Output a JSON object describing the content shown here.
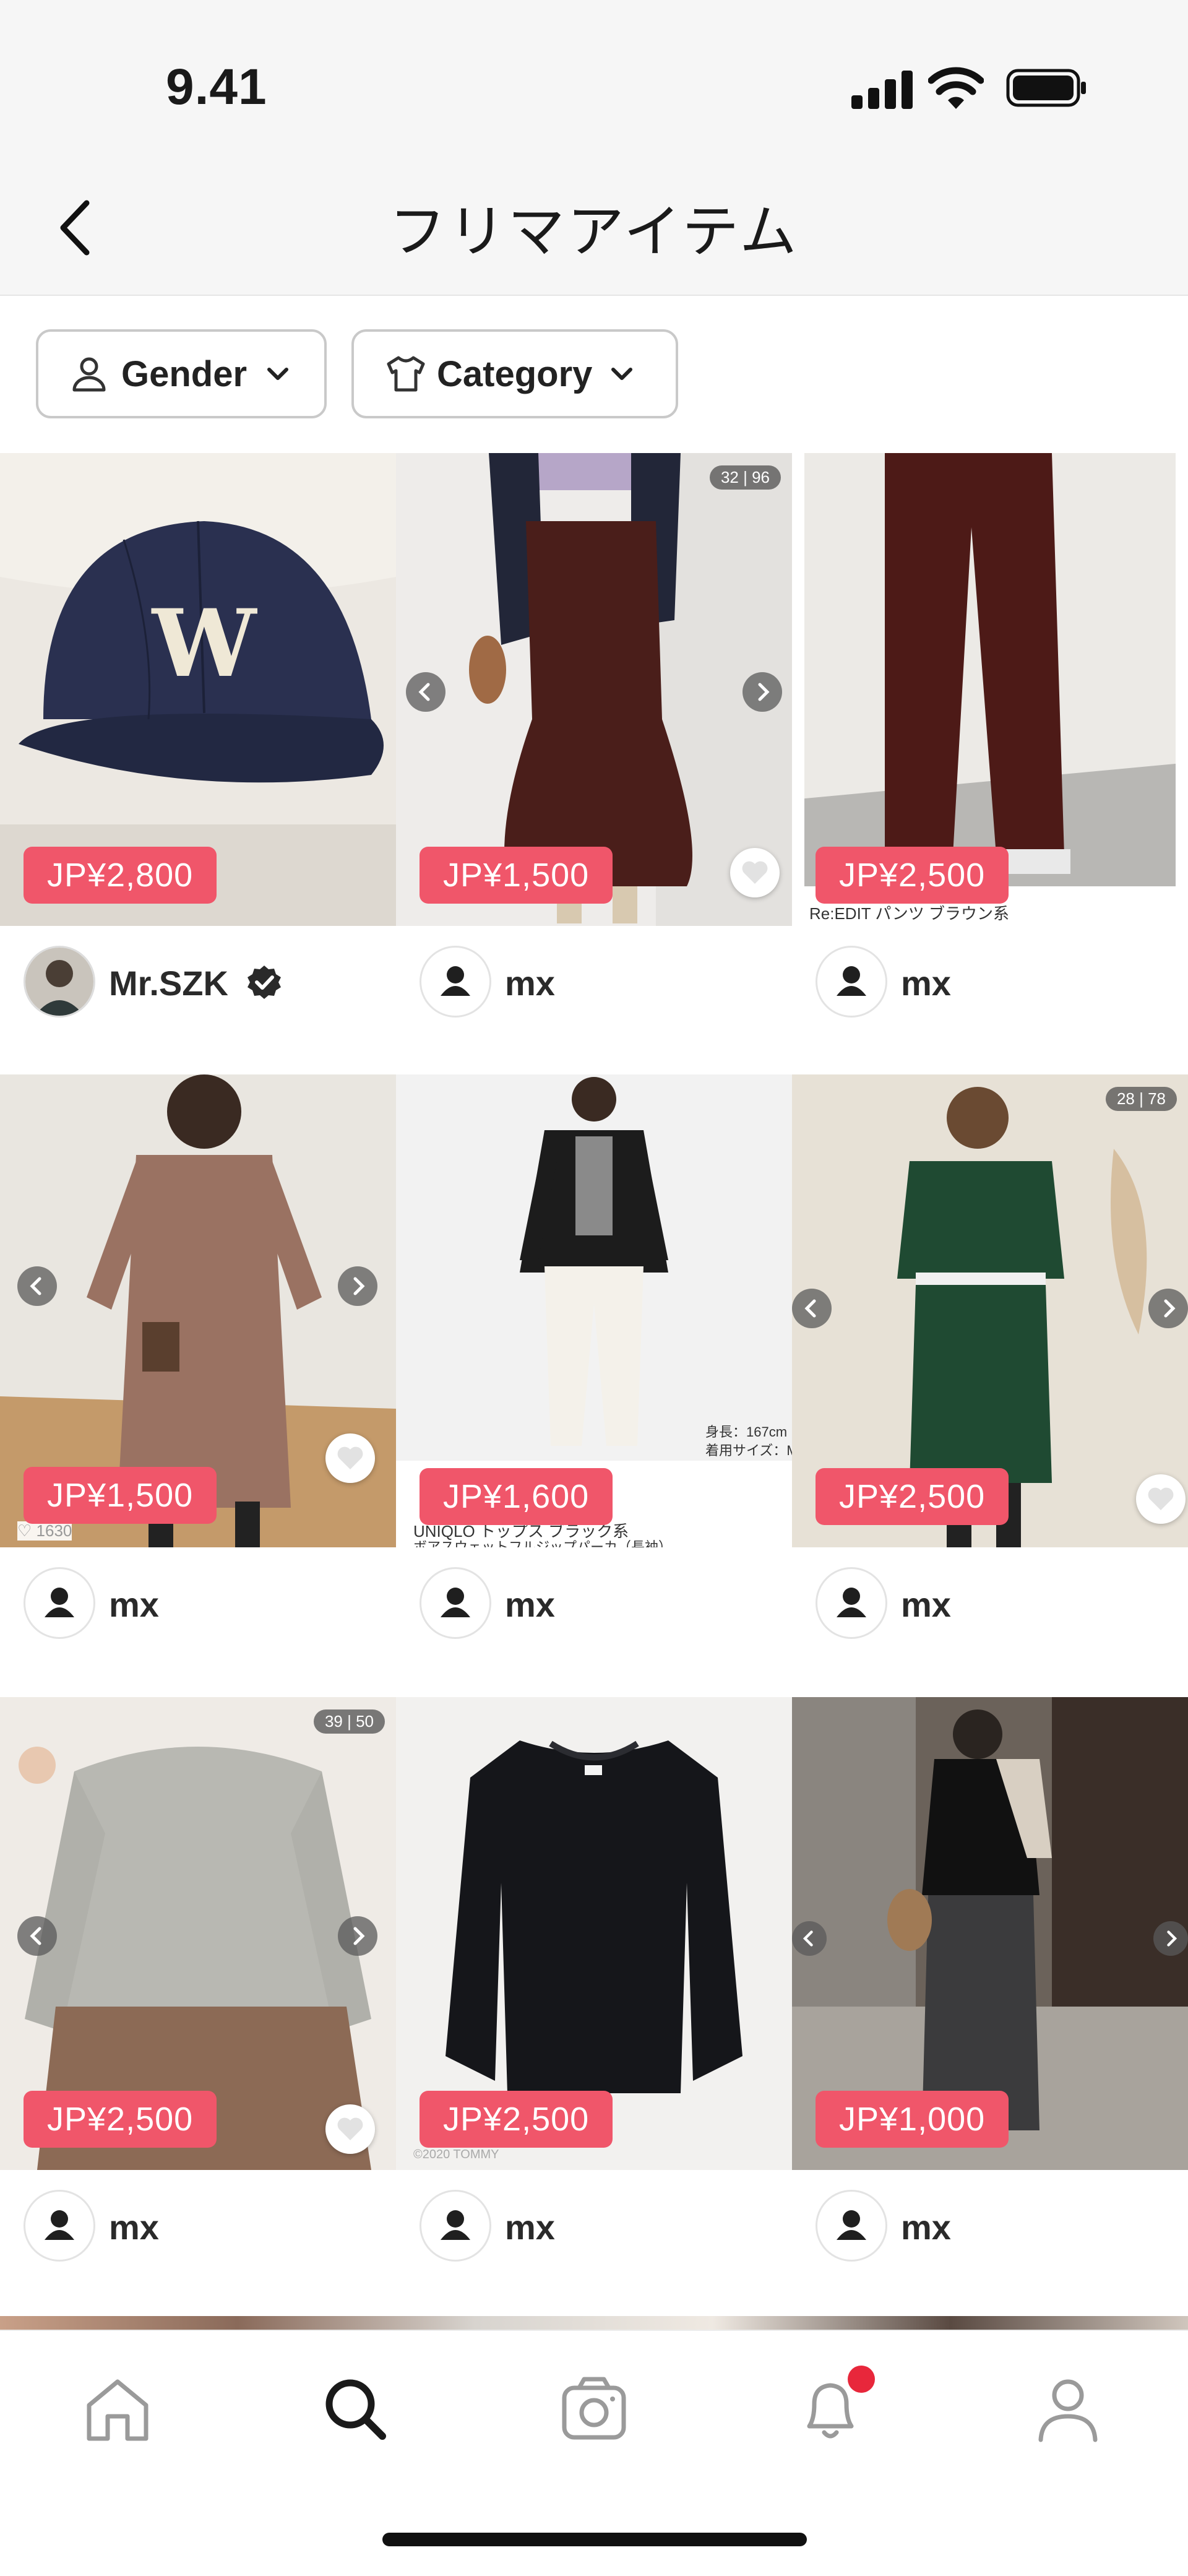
{
  "status_bar": {
    "time": "9.41"
  },
  "header": {
    "title": "フリマアイテム"
  },
  "filters": {
    "gender_label": "Gender",
    "category_label": "Category"
  },
  "items": [
    {
      "price": "JP¥2,800",
      "seller": "Mr.SZK",
      "verified": true,
      "image": "navy-baseball-cap"
    },
    {
      "price": "JP¥1,500",
      "seller": "mx",
      "image": "brown-mermaid-skirt",
      "counter": "32 | 96"
    },
    {
      "price": "JP¥2,500",
      "seller": "mx",
      "image": "brown-wide-pants",
      "caption": "Re:EDIT パンツ ブラウン系"
    },
    {
      "price": "JP¥1,500",
      "seller": "mx",
      "image": "mocha-knit-dress",
      "caption": "♡ 1630"
    },
    {
      "price": "JP¥1,600",
      "seller": "mx",
      "image": "black-zip-hoodie",
      "caption": "UNIQLO トップス ブラック系",
      "caption2": "ボアスウェットフルジップパーカ（長袖）",
      "note1": "身長：167cm",
      "note2": "着用サイズ：M"
    },
    {
      "price": "JP¥2,500",
      "seller": "mx",
      "image": "green-hoodie-set",
      "counter": "28 | 78"
    },
    {
      "price": "JP¥2,500",
      "seller": "mx",
      "image": "grey-rib-knit",
      "counter": "39 | 50"
    },
    {
      "price": "JP¥2,500",
      "seller": "mx",
      "image": "black-cable-sweater",
      "caption": "©2020 TOMMY"
    },
    {
      "price": "JP¥1,000",
      "seller": "mx",
      "image": "charcoal-knit-skirt"
    }
  ],
  "tab_bar": {
    "icons": [
      "home-icon",
      "search-icon",
      "camera-icon",
      "bell-icon",
      "profile-icon"
    ],
    "active": "search-icon",
    "notification_dot_color": "#e8273b"
  },
  "colors": {
    "price_badge": "#f0566a",
    "header_bg": "#f6f6f6"
  }
}
